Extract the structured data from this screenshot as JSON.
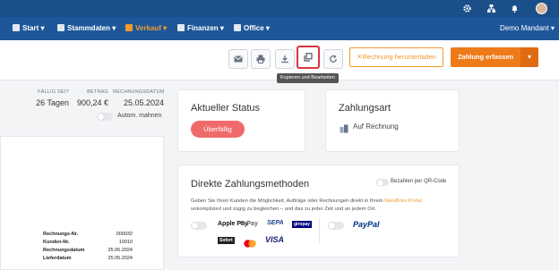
{
  "topbar": {
    "icons": [
      "gear-icon",
      "sitemap-icon",
      "bell-icon",
      "user-avatar"
    ]
  },
  "nav": {
    "start": "Start ▾",
    "stammdaten": "Stammdaten ▾",
    "verkauf": "Verkauf ▾",
    "finanzen": "Finanzen ▾",
    "office": "Office ▾",
    "mandant": "Demo Mandant ▾"
  },
  "toolbar": {
    "tooltip": "Kopieren und Bearbeiten",
    "download_label": "Rechnung herunterladen",
    "pay_label": "Zahlung erfassen",
    "dropdown": "▾",
    "icons": [
      "mail-icon",
      "print-icon",
      "download-icon",
      "copy-edit-icon",
      "refresh-icon"
    ]
  },
  "invoice_meta": {
    "due_label": "FÄLLIG SEIT",
    "due_value": "26 Tagen",
    "amount_label": "BETRAG",
    "amount_value": "900,24 €",
    "date_label": "RECHNUNGSDATUM",
    "date_value": "25.05.2024",
    "auto_reminder": "Autom. mahnen"
  },
  "doc_preview": {
    "rows": [
      {
        "label": "Rechnungs-Nr.",
        "value": "000032"
      },
      {
        "label": "Kunden-Nr.",
        "value": "10010"
      },
      {
        "label": "Rechnungsdatum",
        "value": "25.05.2024"
      },
      {
        "label": "Lieferdatum",
        "value": "25.05.2024"
      }
    ]
  },
  "status_card": {
    "title": "Aktueller Status",
    "badge": "Überfällig",
    "badge_color": "#ef6b6b"
  },
  "payment_card": {
    "title": "Zahlungsart",
    "value": "Auf Rechnung"
  },
  "direct_card": {
    "title": "Direkte Zahlungsmethoden",
    "qr_label": "Bezahlen per QR-Code",
    "text_pre": "Geben Sie Ihren Kunden die Möglichkeit, Aufträge oder Rechnungen direkt in Ihrem ",
    "link": "MeinBüro Portal",
    "text_post": " unkompliziert und zügig zu begleichen – und das zu jeder Zeit und an jedem Ort.",
    "logos": [
      "Apple Pay",
      "G Pay",
      "SEPA",
      "giropay",
      "Sofort",
      "Mastercard",
      "VISA",
      "PayPal"
    ]
  },
  "colors": {
    "nav_bg": "#1e5799",
    "accent": "#ee7a1a",
    "overdue": "#ef6b6b"
  }
}
